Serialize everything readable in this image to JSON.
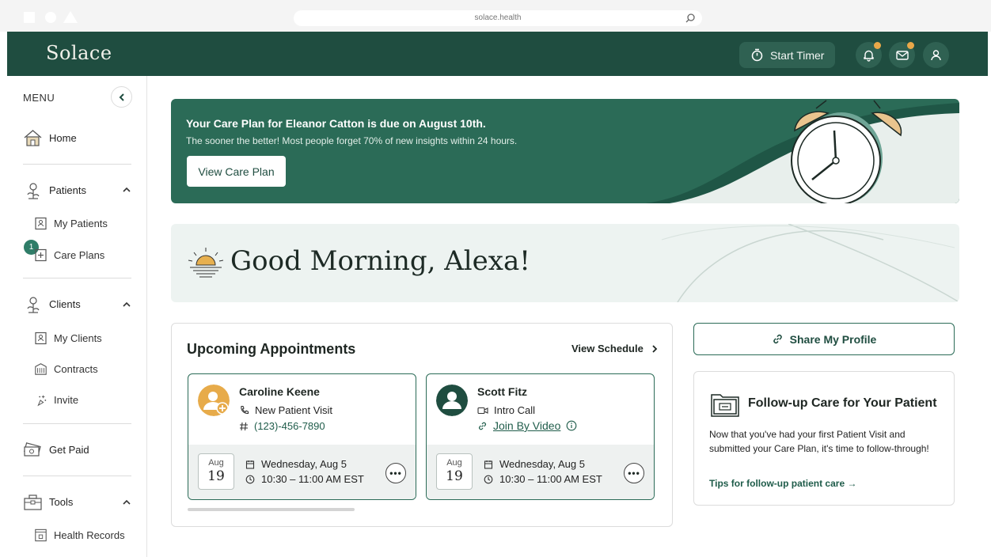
{
  "browser": {
    "url": "solace.health"
  },
  "header": {
    "logo": "Solace",
    "timer_label": "Start Timer"
  },
  "sidebar": {
    "menu_label": "MENU",
    "home": "Home",
    "patients": {
      "label": "Patients",
      "my_patients": "My Patients",
      "care_plans": "Care Plans",
      "care_plans_badge": "1"
    },
    "clients": {
      "label": "Clients",
      "my_clients": "My Clients",
      "contracts": "Contracts",
      "invite": "Invite"
    },
    "get_paid": "Get Paid",
    "tools": {
      "label": "Tools",
      "health_records": "Health Records"
    }
  },
  "banner": {
    "title": "Your Care Plan for Eleanor Catton is due on August 10th.",
    "subtitle": "The sooner the better! Most people forget 70% of new insights within 24 hours.",
    "button": "View Care Plan"
  },
  "greeting": "Good Morning, Alexa!",
  "appointments": {
    "title": "Upcoming Appointments",
    "view_schedule": "View Schedule",
    "cards": [
      {
        "name": "Caroline Keene",
        "type": "New Patient Visit",
        "contact": "(123)-456-7890",
        "month": "Aug",
        "day": "19",
        "date": "Wednesday, Aug 5",
        "time": "10:30 – 11:00 AM EST"
      },
      {
        "name": "Scott Fitz",
        "type": "Intro Call",
        "contact": "Join By Video",
        "month": "Aug",
        "day": "19",
        "date": "Wednesday, Aug 5",
        "time": "10:30 – 11:00 AM EST"
      }
    ]
  },
  "share": {
    "label": "Share My Profile"
  },
  "follow_up": {
    "title": "Follow-up Care for Your Patient",
    "body": "Now that you've had your first Patient Visit and submitted your Care Plan, it's time to follow-through!",
    "link": "Tips for follow-up patient care →"
  },
  "colors": {
    "brand": "#1f4d40",
    "accent": "#2b6b57",
    "notification": "#e9a849"
  }
}
